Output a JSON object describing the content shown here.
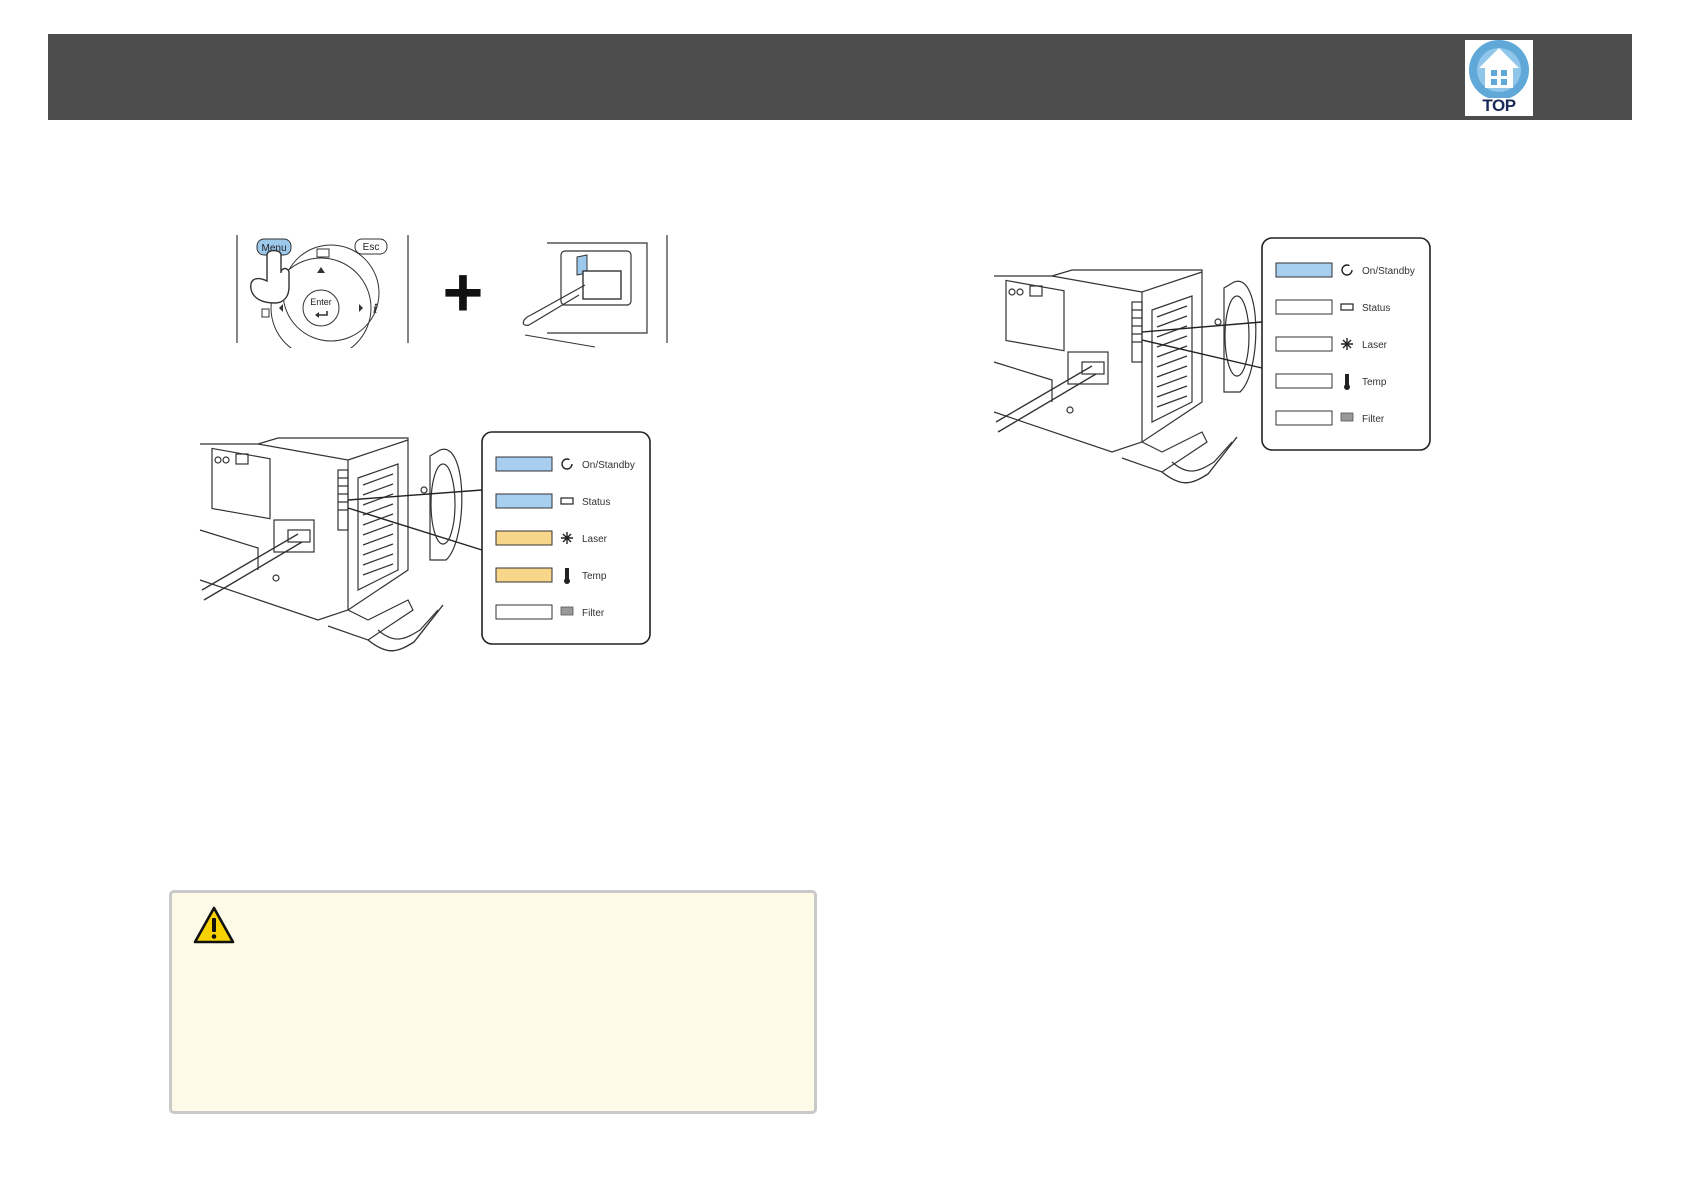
{
  "header": {
    "top_button_label": "TOP",
    "top_button_icon": "house-icon",
    "background_color": "#4d4d4d"
  },
  "remote": {
    "menu_label": "Menu",
    "esc_label": "Esc",
    "enter_label": "Enter",
    "plus_symbol": "+"
  },
  "indicator_panel_left": {
    "items": [
      {
        "label": "On/Standby",
        "icon": "power-icon",
        "state_color": "#a8cff0"
      },
      {
        "label": "Status",
        "icon": "projector-icon",
        "state_color": "#a8cff0"
      },
      {
        "label": "Laser",
        "icon": "laser-icon",
        "state_color": "#f7d68a"
      },
      {
        "label": "Temp",
        "icon": "thermometer-icon",
        "state_color": "#f7d68a"
      },
      {
        "label": "Filter",
        "icon": "filter-icon",
        "state_color": "#ffffff"
      }
    ]
  },
  "indicator_panel_right": {
    "items": [
      {
        "label": "On/Standby",
        "icon": "power-icon",
        "state_color": "#a8cff0"
      },
      {
        "label": "Status",
        "icon": "projector-icon",
        "state_color": "#ffffff"
      },
      {
        "label": "Laser",
        "icon": "laser-icon",
        "state_color": "#ffffff"
      },
      {
        "label": "Temp",
        "icon": "thermometer-icon",
        "state_color": "#ffffff"
      },
      {
        "label": "Filter",
        "icon": "filter-icon",
        "state_color": "#ffffff"
      }
    ]
  },
  "caution": {
    "icon": "warning-icon",
    "background_color": "#fefae8"
  }
}
